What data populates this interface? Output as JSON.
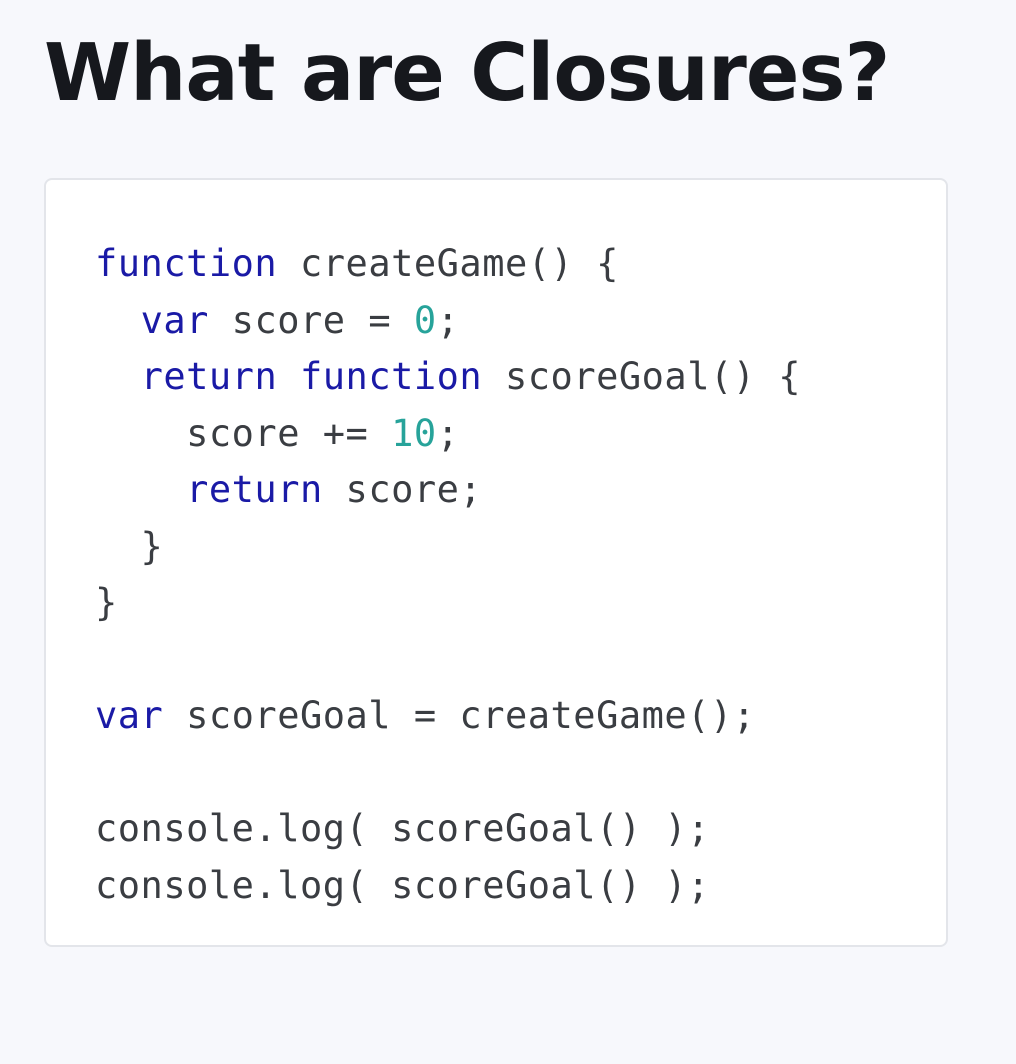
{
  "title": "What are Closures?",
  "colors": {
    "background": "#f7f8fc",
    "title": "#16181d",
    "keyword": "#1a1aa6",
    "number": "#27a39a",
    "text": "#3a3d42"
  },
  "code": {
    "language": "javascript",
    "lines": [
      [
        {
          "t": "kw",
          "v": "function"
        },
        {
          "t": "plain",
          "v": " createGame() {"
        }
      ],
      [
        {
          "t": "plain",
          "v": "  "
        },
        {
          "t": "kw",
          "v": "var"
        },
        {
          "t": "plain",
          "v": " score = "
        },
        {
          "t": "num",
          "v": "0"
        },
        {
          "t": "plain",
          "v": ";"
        }
      ],
      [
        {
          "t": "plain",
          "v": "  "
        },
        {
          "t": "kw",
          "v": "return"
        },
        {
          "t": "plain",
          "v": " "
        },
        {
          "t": "kw",
          "v": "function"
        },
        {
          "t": "plain",
          "v": " scoreGoal() {"
        }
      ],
      [
        {
          "t": "plain",
          "v": "    score += "
        },
        {
          "t": "num",
          "v": "10"
        },
        {
          "t": "plain",
          "v": ";"
        }
      ],
      [
        {
          "t": "plain",
          "v": "    "
        },
        {
          "t": "kw",
          "v": "return"
        },
        {
          "t": "plain",
          "v": " score;"
        }
      ],
      [
        {
          "t": "plain",
          "v": "  }"
        }
      ],
      [
        {
          "t": "plain",
          "v": "}"
        }
      ],
      [],
      [
        {
          "t": "kw",
          "v": "var"
        },
        {
          "t": "plain",
          "v": " scoreGoal = createGame();"
        }
      ],
      [],
      [
        {
          "t": "plain",
          "v": "console.log( scoreGoal() );"
        }
      ],
      [
        {
          "t": "plain",
          "v": "console.log( scoreGoal() );"
        }
      ]
    ]
  }
}
